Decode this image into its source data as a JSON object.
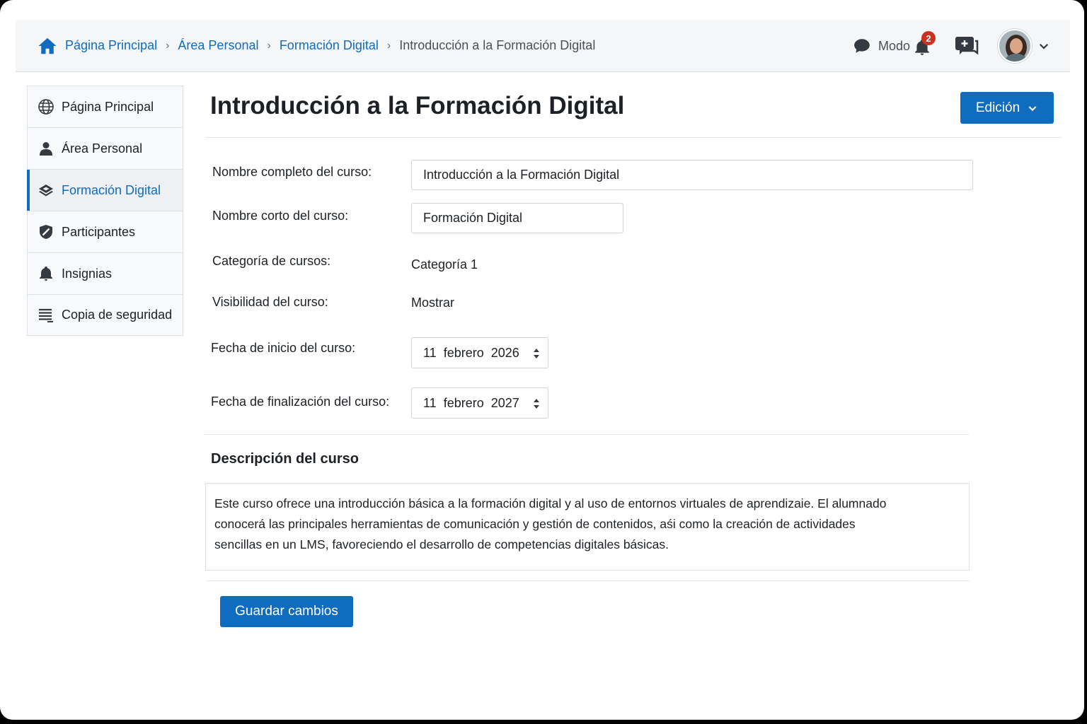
{
  "breadcrumb": {
    "items": [
      "Página Principal",
      "Área Personal",
      "Formación Digital"
    ],
    "current": "Introducción a la Formación Digital"
  },
  "header": {
    "mode_label": "Modo",
    "notification_count": "2",
    "icons": [
      "home-icon",
      "chat-icon",
      "bell-icon",
      "message-add-icon",
      "avatar",
      "chevron-down-icon"
    ]
  },
  "sidebar": {
    "items": [
      {
        "label": "Página Principal",
        "icon": "globe-icon"
      },
      {
        "label": "Área Personal",
        "icon": "user-icon"
      },
      {
        "label": "Formación Digital",
        "icon": "layers-icon",
        "active": true
      },
      {
        "label": "Participantes",
        "icon": "badge-shield-icon"
      },
      {
        "label": "Insignias",
        "icon": "bell-icon"
      },
      {
        "label": "Copia de seguridad",
        "icon": "list-icon"
      }
    ]
  },
  "main": {
    "title": "Introducción a la Formación Digital",
    "edit_button": "Edición",
    "fields": {
      "fullname_label": "Nombre completo del curso:",
      "fullname_value": "Introducción a la Formación Digital",
      "shortname_label": "Nombre corto del curso:",
      "shortname_value": "Formación Digital",
      "category_label": "Categoría de cursos:",
      "category_value": "Categoría 1",
      "visibility_label": "Visibilidad del curso:",
      "visibility_value": "Mostrar",
      "start_label": "Fecha de inicio del curso:",
      "start_day": "11",
      "start_month": "febrero",
      "start_year": "2026",
      "end_label": "Fecha de finalización del curso:",
      "end_day": "11",
      "end_month": "febrero",
      "end_year": "2027"
    },
    "description_title": "Descripción del curso",
    "description_lines": [
      "Este curso ofrece una introducción básica a la formación digital y al uso de entornos virtuales de aprendizaie. El alumnado",
      "conocerá las principales herramientas de comunicación y gestión de contenidos, aśi como la creación de actividades",
      "sencillas en un LMS, favoreciendo el desarrollo de competencias digitales básicas."
    ],
    "save_button": "Guardar cambios"
  },
  "colors": {
    "accent": "#0f6cbf",
    "badge": "#ca3120",
    "header_bg": "#f5f6f8"
  }
}
